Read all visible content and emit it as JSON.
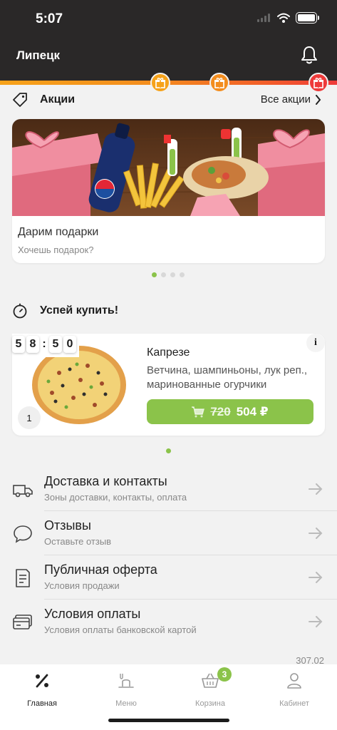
{
  "status": {
    "time": "5:07"
  },
  "header": {
    "city": "Липецк"
  },
  "gift_progress": {
    "colors": [
      "#f6a21a",
      "#f38d1e",
      "#ee3a3a"
    ]
  },
  "promos": {
    "title": "Акции",
    "all_label": "Все акции",
    "card": {
      "title": "Дарим подарки",
      "subtitle": "Хочешь подарок?",
      "brand_on_bottle": "pepsi"
    },
    "pages": 4,
    "active_page": 0
  },
  "hurry": {
    "title": "Успей купить!",
    "timer": [
      "5",
      "8",
      "5",
      "0"
    ],
    "timer_sep": ":",
    "product": {
      "name": "Капрезе",
      "description": "Ветчина, шампиньоны, лук реп., маринованные огурчики",
      "old_price": "720",
      "new_price": "504 ₽",
      "quantity": "1",
      "info_label": "i"
    },
    "pages": 1
  },
  "menu": [
    {
      "title": "Доставка и контакты",
      "subtitle": "Зоны доставки, контакты, оплата",
      "icon": "truck-icon"
    },
    {
      "title": "Отзывы",
      "subtitle": "Оставьте отзыв",
      "icon": "chat-bubble-icon"
    },
    {
      "title": "Публичная оферта",
      "subtitle": "Условия продажи",
      "icon": "document-icon"
    },
    {
      "title": "Условия оплаты",
      "subtitle": "Условия оплаты банковской картой",
      "icon": "card-icon"
    }
  ],
  "version": "307.02",
  "tabs": [
    {
      "label": "Главная",
      "icon": "percent-icon",
      "active": true
    },
    {
      "label": "Меню",
      "icon": "menu-food-icon",
      "active": false
    },
    {
      "label": "Корзина",
      "icon": "basket-icon",
      "active": false,
      "badge": "3"
    },
    {
      "label": "Кабинет",
      "icon": "user-icon",
      "active": false
    }
  ],
  "colors": {
    "accent": "#8bc34a",
    "topbar": "#2a2828",
    "gift_orange": "#f6a21a",
    "gift_red": "#ee3a3a"
  }
}
